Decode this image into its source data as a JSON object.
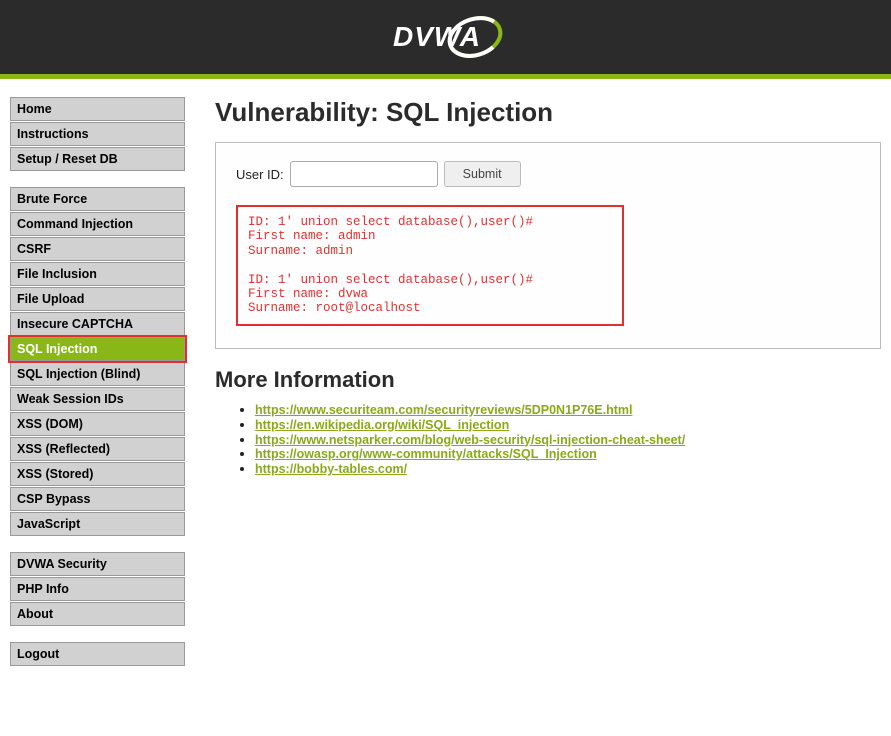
{
  "header": {
    "logo_text": "DVWA"
  },
  "sidebar": {
    "groups": [
      {
        "items": [
          {
            "label": "Home",
            "active": false
          },
          {
            "label": "Instructions",
            "active": false
          },
          {
            "label": "Setup / Reset DB",
            "active": false
          }
        ]
      },
      {
        "items": [
          {
            "label": "Brute Force",
            "active": false
          },
          {
            "label": "Command Injection",
            "active": false
          },
          {
            "label": "CSRF",
            "active": false
          },
          {
            "label": "File Inclusion",
            "active": false
          },
          {
            "label": "File Upload",
            "active": false
          },
          {
            "label": "Insecure CAPTCHA",
            "active": false
          },
          {
            "label": "SQL Injection",
            "active": true
          },
          {
            "label": "SQL Injection (Blind)",
            "active": false
          },
          {
            "label": "Weak Session IDs",
            "active": false
          },
          {
            "label": "XSS (DOM)",
            "active": false
          },
          {
            "label": "XSS (Reflected)",
            "active": false
          },
          {
            "label": "XSS (Stored)",
            "active": false
          },
          {
            "label": "CSP Bypass",
            "active": false
          },
          {
            "label": "JavaScript",
            "active": false
          }
        ]
      },
      {
        "items": [
          {
            "label": "DVWA Security",
            "active": false
          },
          {
            "label": "PHP Info",
            "active": false
          },
          {
            "label": "About",
            "active": false
          }
        ]
      },
      {
        "items": [
          {
            "label": "Logout",
            "active": false
          }
        ]
      }
    ]
  },
  "main": {
    "title": "Vulnerability: SQL Injection",
    "form": {
      "label": "User ID:",
      "value": "",
      "submit": "Submit"
    },
    "output": "ID: 1' union select database(),user()#\nFirst name: admin\nSurname: admin\n\nID: 1' union select database(),user()#\nFirst name: dvwa\nSurname: root@localhost",
    "more_info_heading": "More Information",
    "links": [
      "https://www.securiteam.com/securityreviews/5DP0N1P76E.html",
      "https://en.wikipedia.org/wiki/SQL_injection",
      "https://www.netsparker.com/blog/web-security/sql-injection-cheat-sheet/",
      "https://owasp.org/www-community/attacks/SQL_Injection",
      "https://bobby-tables.com/"
    ]
  }
}
